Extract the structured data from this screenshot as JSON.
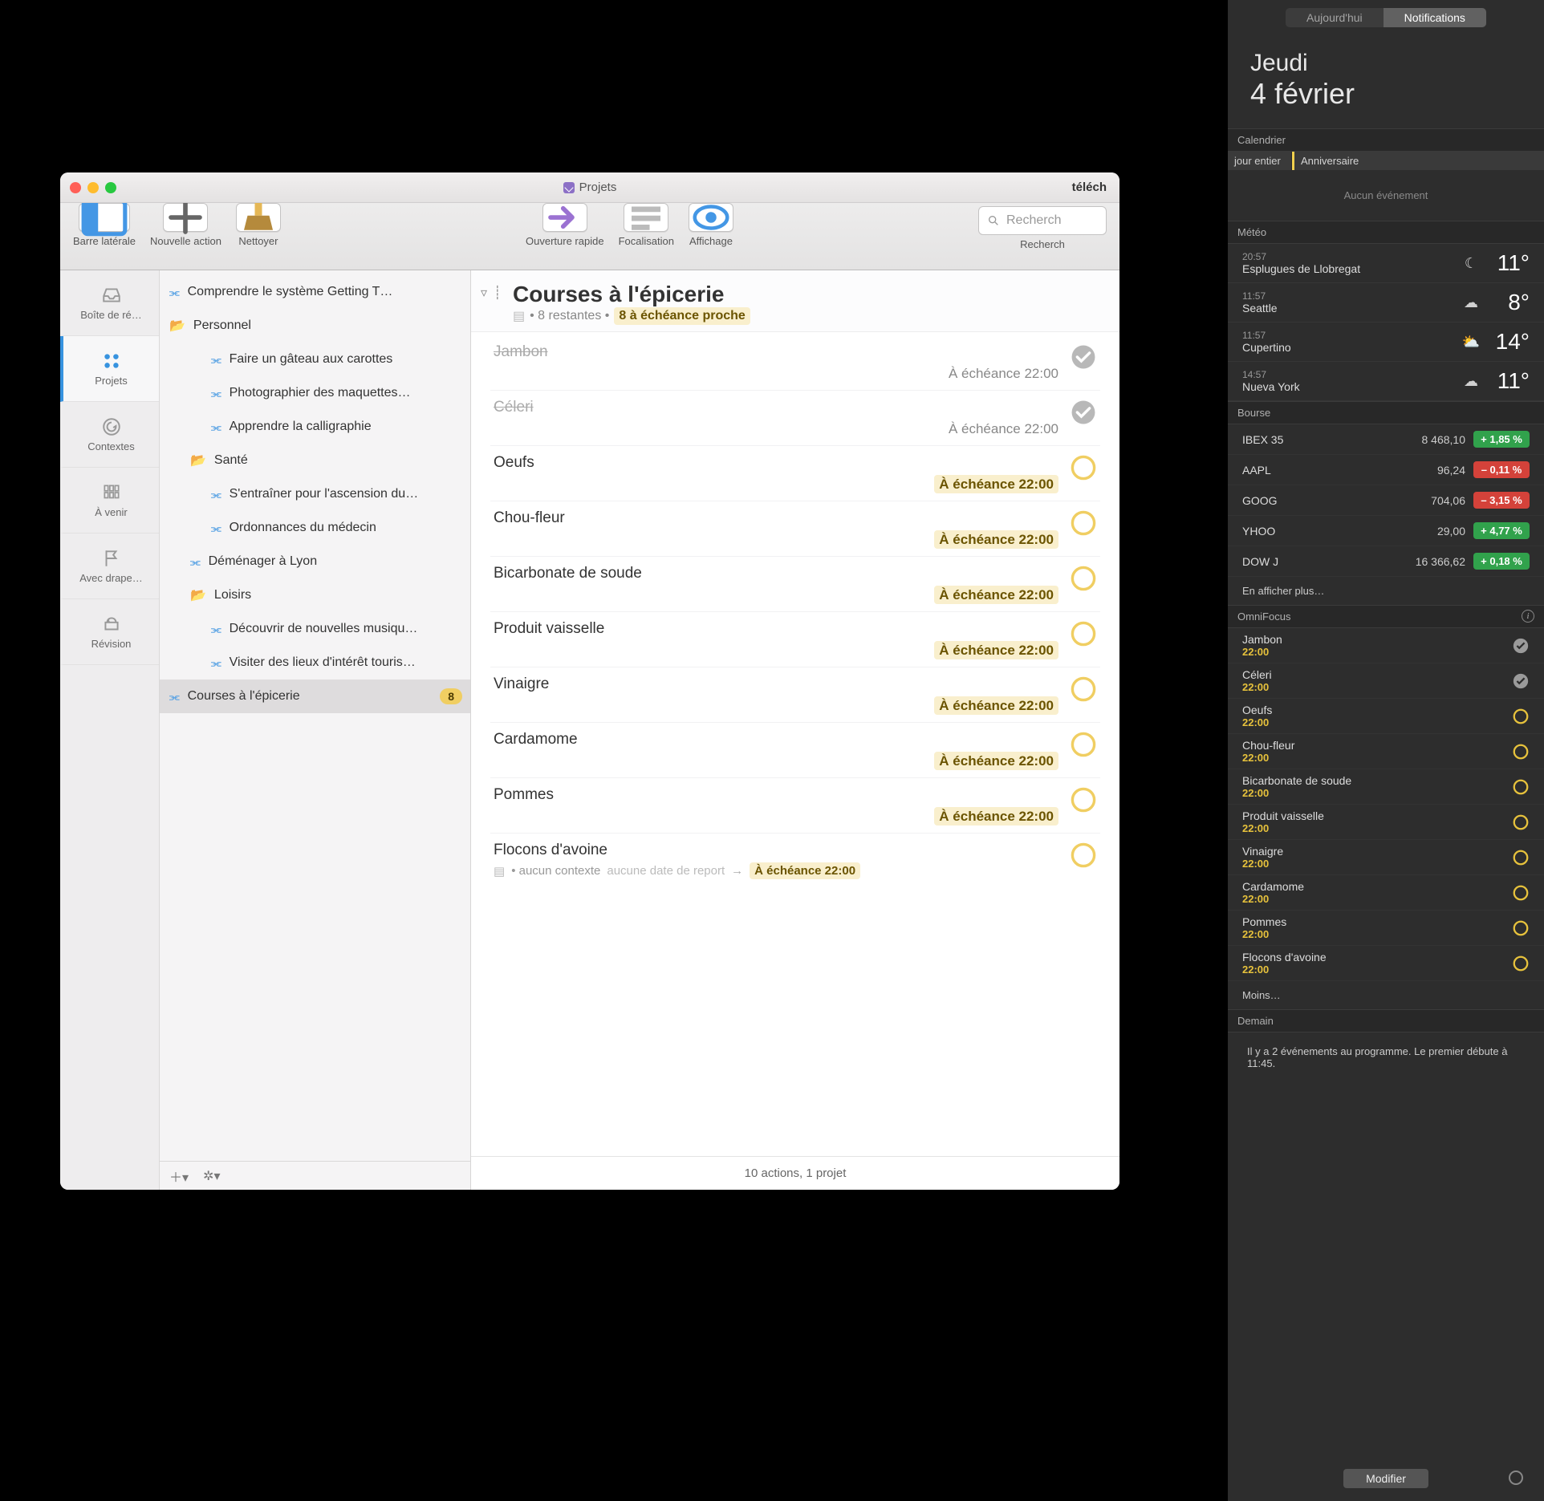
{
  "window": {
    "title": "Projets",
    "titlebar_right": "téléch",
    "toolbar": [
      {
        "id": "sidebar",
        "label": "Barre latérale"
      },
      {
        "id": "newaction",
        "label": "Nouvelle action"
      },
      {
        "id": "cleanup",
        "label": "Nettoyer"
      },
      {
        "id": "quickopen",
        "label": "Ouverture rapide"
      },
      {
        "id": "focus",
        "label": "Focalisation"
      },
      {
        "id": "view",
        "label": "Affichage"
      }
    ],
    "search_placeholder": "Recherch",
    "search_label": "Recherch"
  },
  "perspectives": [
    {
      "id": "inbox",
      "label": "Boîte de ré…"
    },
    {
      "id": "projects",
      "label": "Projets",
      "selected": true
    },
    {
      "id": "contexts",
      "label": "Contextes"
    },
    {
      "id": "forecast",
      "label": "À venir"
    },
    {
      "id": "flagged",
      "label": "Avec drape…"
    },
    {
      "id": "review",
      "label": "Révision"
    }
  ],
  "outline": [
    {
      "type": "project",
      "name": "Comprendre le système Getting T…",
      "indent": 0
    },
    {
      "type": "folder",
      "name": "Personnel",
      "indent": 0
    },
    {
      "type": "project",
      "name": "Faire un gâteau aux carottes",
      "indent": 2
    },
    {
      "type": "project",
      "name": "Photographier des maquettes…",
      "indent": 2
    },
    {
      "type": "project",
      "name": "Apprendre la calligraphie",
      "indent": 2
    },
    {
      "type": "folder",
      "name": "Santé",
      "indent": 1
    },
    {
      "type": "project",
      "name": "S'entraîner pour l'ascension du…",
      "indent": 2
    },
    {
      "type": "project",
      "name": "Ordonnances du médecin",
      "indent": 2
    },
    {
      "type": "project",
      "name": "Déménager à Lyon",
      "indent": 1
    },
    {
      "type": "folder",
      "name": "Loisirs",
      "indent": 1
    },
    {
      "type": "project",
      "name": "Découvrir de nouvelles musiqu…",
      "indent": 2
    },
    {
      "type": "project",
      "name": "Visiter des lieux d'intérêt touris…",
      "indent": 2
    },
    {
      "type": "project",
      "name": "Courses à l'épicerie",
      "indent": 0,
      "selected": true,
      "badge": "8"
    }
  ],
  "content": {
    "title": "Courses à l'épicerie",
    "sub_remaining": "• 8 restantes •",
    "sub_due": "8 à échéance proche",
    "tasks": [
      {
        "name": "Jambon",
        "done": true,
        "due": "À échéance 22:00",
        "soon": false
      },
      {
        "name": "Céleri",
        "done": true,
        "due": "À échéance 22:00",
        "soon": false
      },
      {
        "name": "Oeufs",
        "done": false,
        "due": "À échéance 22:00",
        "soon": true
      },
      {
        "name": "Chou-fleur",
        "done": false,
        "due": "À échéance 22:00",
        "soon": true
      },
      {
        "name": "Bicarbonate de soude",
        "done": false,
        "due": "À échéance 22:00",
        "soon": true
      },
      {
        "name": "Produit vaisselle",
        "done": false,
        "due": "À échéance 22:00",
        "soon": true
      },
      {
        "name": "Vinaigre",
        "done": false,
        "due": "À échéance 22:00",
        "soon": true
      },
      {
        "name": "Cardamome",
        "done": false,
        "due": "À échéance 22:00",
        "soon": true
      },
      {
        "name": "Pommes",
        "done": false,
        "due": "À échéance 22:00",
        "soon": true
      },
      {
        "name": "Flocons d'avoine",
        "done": false,
        "due": "À échéance 22:00",
        "soon": true,
        "extra_context": "• aucun contexte",
        "extra_defer": "aucune date de report",
        "selected": true
      }
    ],
    "footer": "10 actions, 1 projet"
  },
  "nc": {
    "tabs": {
      "today": "Aujourd'hui",
      "notifications": "Notifications"
    },
    "date_day": "Jeudi",
    "date_num": "4 février",
    "calendar": {
      "header": "Calendrier",
      "allday": "jour entier",
      "event": "Anniversaire",
      "noevent": "Aucun événement"
    },
    "weather": {
      "header": "Météo",
      "rows": [
        {
          "time": "20:57",
          "city": "Esplugues de Llobregat",
          "icon": "☾",
          "temp": "11°"
        },
        {
          "time": "11:57",
          "city": "Seattle",
          "icon": "☁",
          "temp": "8°"
        },
        {
          "time": "11:57",
          "city": "Cupertino",
          "icon": "⛅",
          "temp": "14°"
        },
        {
          "time": "14:57",
          "city": "Nueva York",
          "icon": "☁",
          "temp": "11°"
        }
      ]
    },
    "stocks": {
      "header": "Bourse",
      "rows": [
        {
          "tick": "IBEX 35",
          "price": "8 468,10",
          "pct": "+ 1,85 %",
          "dir": "up"
        },
        {
          "tick": "AAPL",
          "price": "96,24",
          "pct": "– 0,11 %",
          "dir": "down"
        },
        {
          "tick": "GOOG",
          "price": "704,06",
          "pct": "– 3,15 %",
          "dir": "down"
        },
        {
          "tick": "YHOO",
          "price": "29,00",
          "pct": "+ 4,77 %",
          "dir": "up"
        },
        {
          "tick": "DOW J",
          "price": "16 366,62",
          "pct": "+ 0,18 %",
          "dir": "up"
        }
      ],
      "more": "En afficher plus…"
    },
    "omnifocus": {
      "header": "OmniFocus",
      "items": [
        {
          "name": "Jambon",
          "time": "22:00",
          "done": true
        },
        {
          "name": "Céleri",
          "time": "22:00",
          "done": true
        },
        {
          "name": "Oeufs",
          "time": "22:00",
          "done": false
        },
        {
          "name": "Chou-fleur",
          "time": "22:00",
          "done": false
        },
        {
          "name": "Bicarbonate de soude",
          "time": "22:00",
          "done": false
        },
        {
          "name": "Produit vaisselle",
          "time": "22:00",
          "done": false
        },
        {
          "name": "Vinaigre",
          "time": "22:00",
          "done": false
        },
        {
          "name": "Cardamome",
          "time": "22:00",
          "done": false
        },
        {
          "name": "Pommes",
          "time": "22:00",
          "done": false
        },
        {
          "name": "Flocons d'avoine",
          "time": "22:00",
          "done": false
        }
      ],
      "less": "Moins…"
    },
    "tomorrow": {
      "header": "Demain",
      "text": "Il y a 2 événements au programme. Le premier débute à 11:45."
    },
    "edit": "Modifier"
  }
}
